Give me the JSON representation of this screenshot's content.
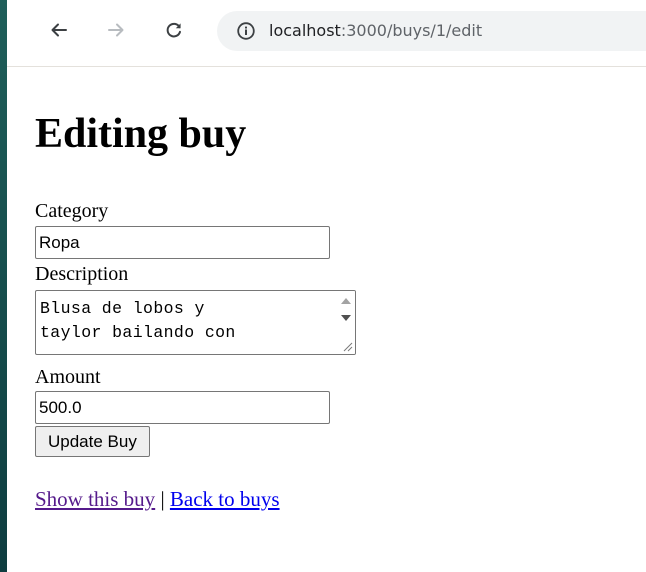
{
  "browser": {
    "url_host": "localhost",
    "url_rest": ":3000/buys/1/edit",
    "colors": {
      "toolbar_icon": "#3c4043",
      "forward_disabled": "#b8bcc0"
    }
  },
  "page": {
    "title": "Editing buy",
    "form": {
      "category_label": "Category",
      "category_value": "Ropa",
      "description_label": "Description",
      "description_value": "Blusa de lobos y\ntaylor bailando con",
      "amount_label": "Amount",
      "amount_value": "500.0",
      "submit_label": "Update Buy"
    },
    "links": {
      "show": "Show this buy",
      "separator": " | ",
      "back": "Back to buys"
    }
  }
}
